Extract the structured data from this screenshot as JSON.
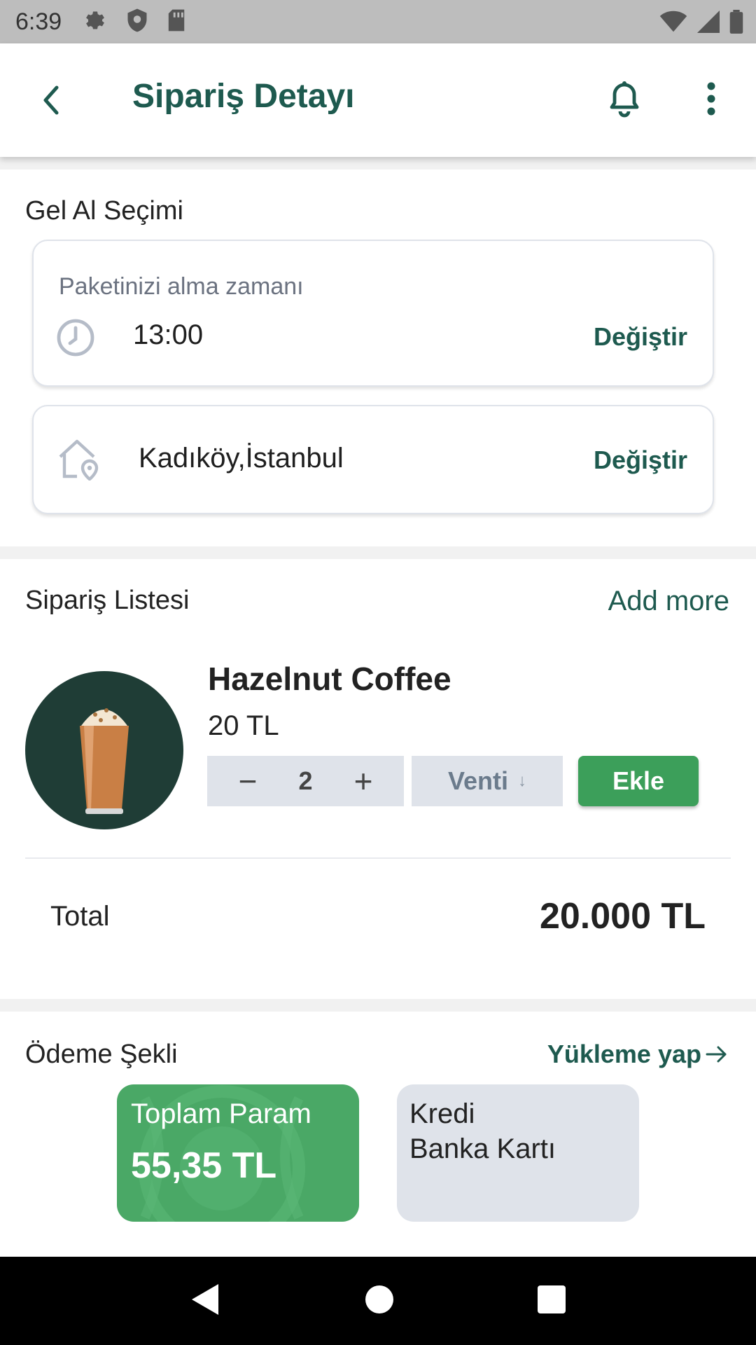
{
  "status_bar": {
    "time": "6:39"
  },
  "header": {
    "title": "Sipariş Detayı"
  },
  "pickup": {
    "section_title": "Gel Al Seçimi",
    "time_caption": "Paketinizi alma zamanı",
    "time_value": "13:00",
    "time_change": "Değiştir",
    "location_value": "Kadıköy,İstanbul",
    "location_change": "Değiştir"
  },
  "order": {
    "section_title": "Sipariş Listesi",
    "add_more": "Add more",
    "item": {
      "name": "Hazelnut Coffee",
      "price": "20 TL",
      "quantity": "2",
      "minus": "−",
      "plus": "+",
      "size": "Venti",
      "size_arrow": "↓",
      "add_label": "Ekle"
    },
    "total_label": "Total",
    "total_value": "20.000 TL"
  },
  "payment": {
    "section_title": "Ödeme Şekli",
    "topup": "Yükleme yap",
    "wallet_label": "Toplam Param",
    "wallet_amount": "55,35 TL",
    "credit_line1": "Kredi",
    "credit_line2": "Banka Kartı"
  },
  "colors": {
    "brand": "#1e5a4f",
    "accent_green": "#3c9f5a",
    "wallet_green": "#4aa866",
    "chip_gray": "#dfe3ea"
  }
}
